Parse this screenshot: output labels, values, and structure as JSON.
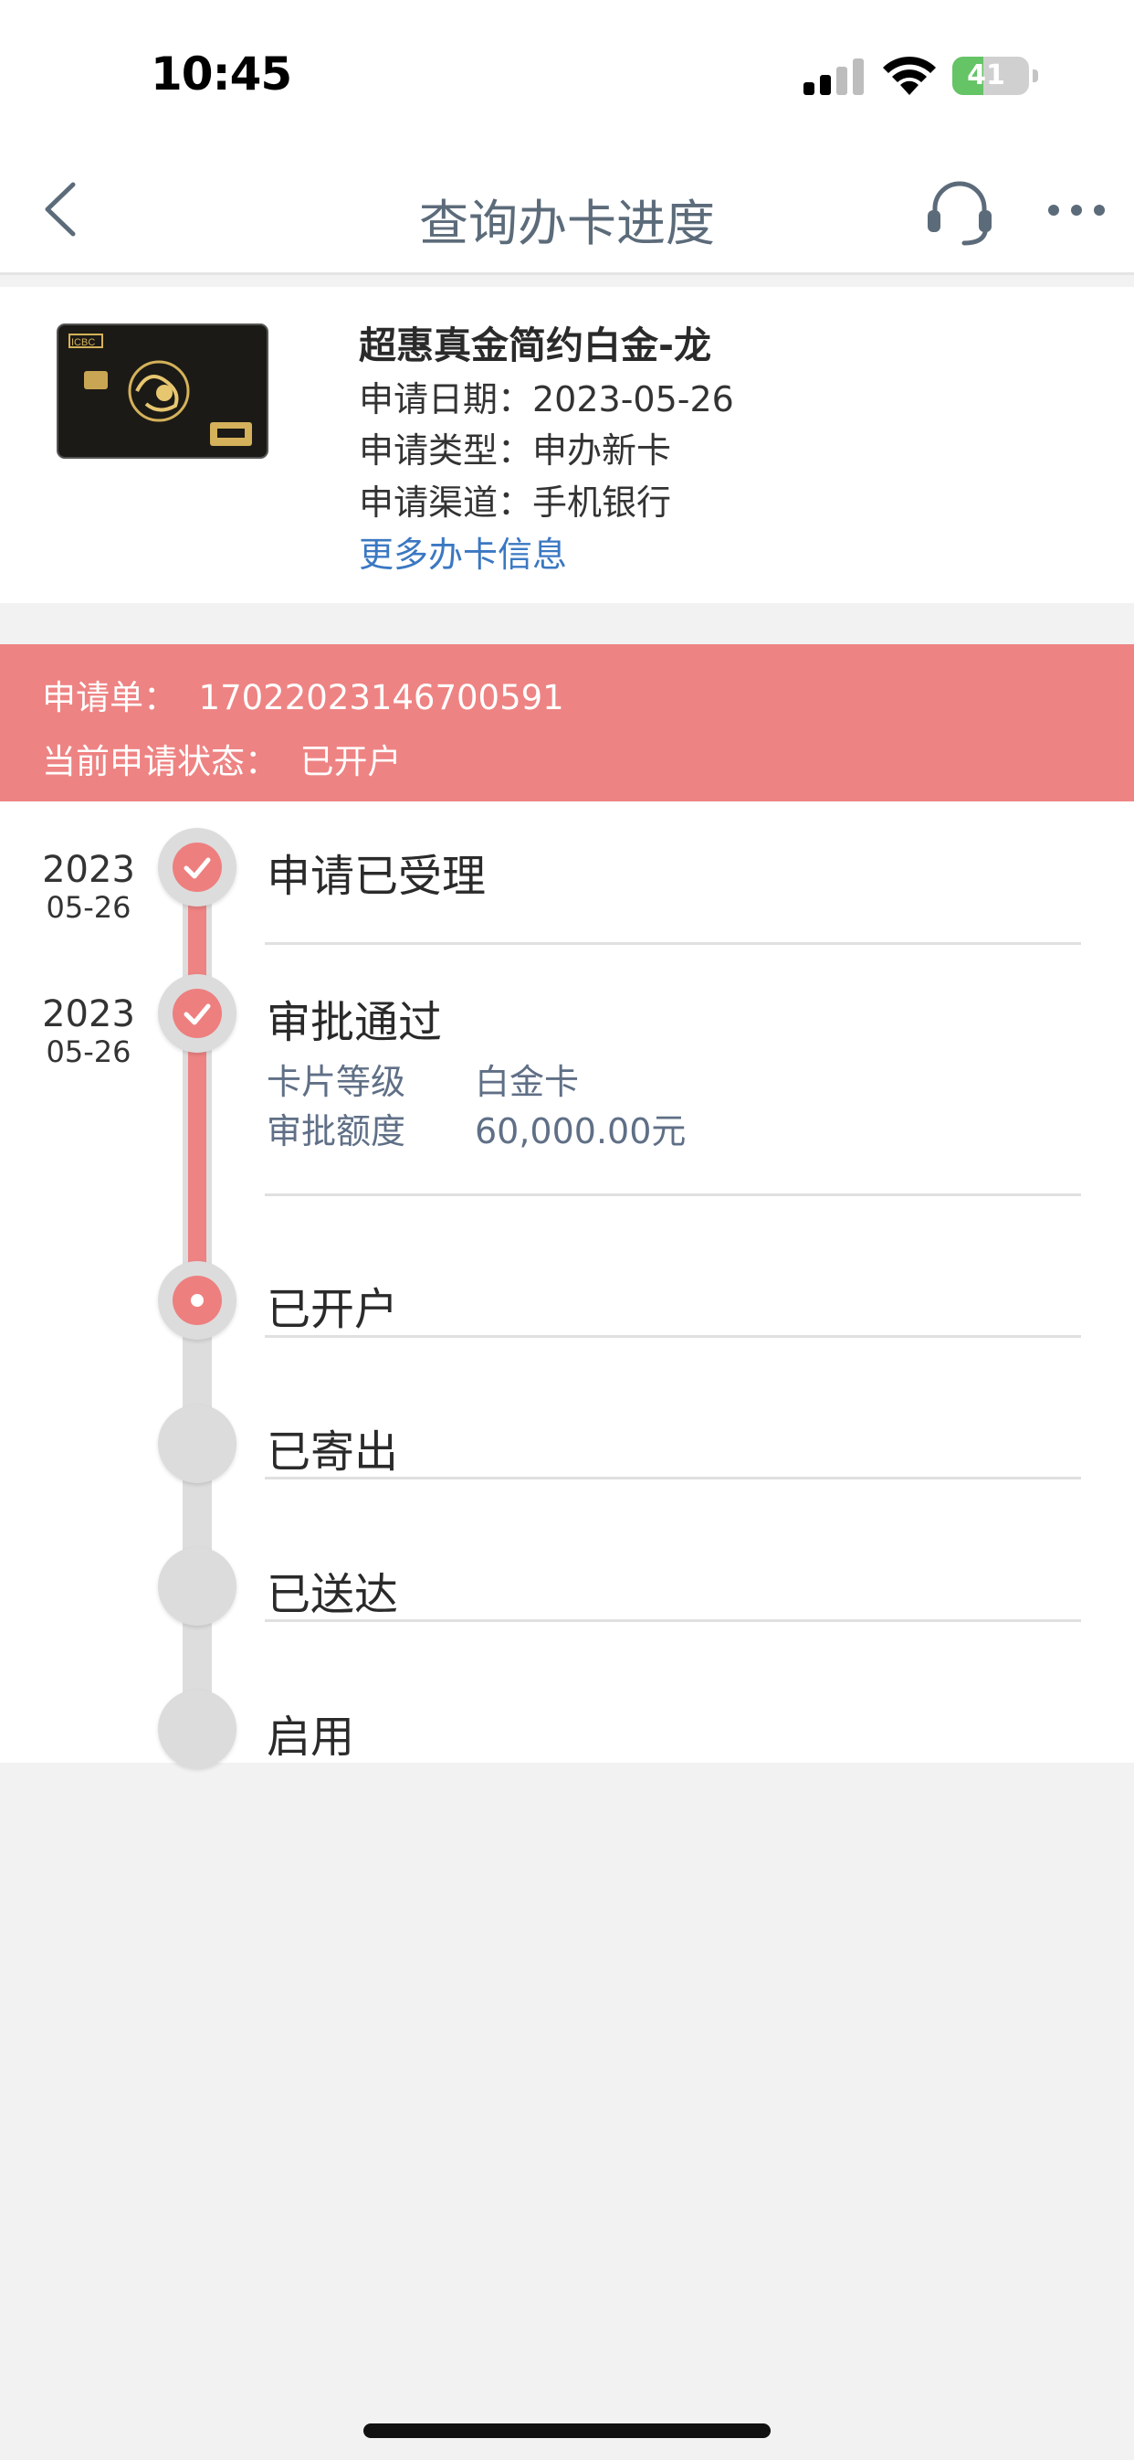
{
  "status_bar": {
    "time": "10:45",
    "battery_text": "41",
    "battery_level": 0.41,
    "battery_color": "#65c466",
    "icons": [
      "cellular-signal-icon",
      "wifi-icon",
      "battery-charging-icon"
    ]
  },
  "nav": {
    "title": "查询办卡进度",
    "icons": [
      "back-chevron-icon",
      "customer-service-headset-icon",
      "more-dots-icon"
    ]
  },
  "card": {
    "name": "超惠真金简约白金-龙",
    "apply_date": "申请日期：2023-05-26",
    "apply_type": "申请类型：申办新卡",
    "apply_channel": "申请渠道：手机银行",
    "more_info_link": "更多办卡信息",
    "image_brand_text": "ICBC"
  },
  "application": {
    "number_label": "申请单：",
    "number": "17022023146700591",
    "status_label": "当前申请状态：",
    "status": "已开户",
    "banner_color": "#ee8383"
  },
  "timeline": {
    "accent_color": "#ee8383",
    "steps": [
      {
        "title": "申请已受理",
        "year": "2023",
        "date": "05-26",
        "state": "completed"
      },
      {
        "title": "审批通过",
        "year": "2023",
        "date": "05-26",
        "state": "completed",
        "details": [
          {
            "label": "卡片等级",
            "value": "白金卡"
          },
          {
            "label": "审批额度",
            "value": "60,000.00元"
          }
        ]
      },
      {
        "title": "已开户",
        "state": "current"
      },
      {
        "title": "已寄出",
        "state": "pending"
      },
      {
        "title": "已送达",
        "state": "pending"
      },
      {
        "title": "启用",
        "state": "pending"
      }
    ]
  }
}
